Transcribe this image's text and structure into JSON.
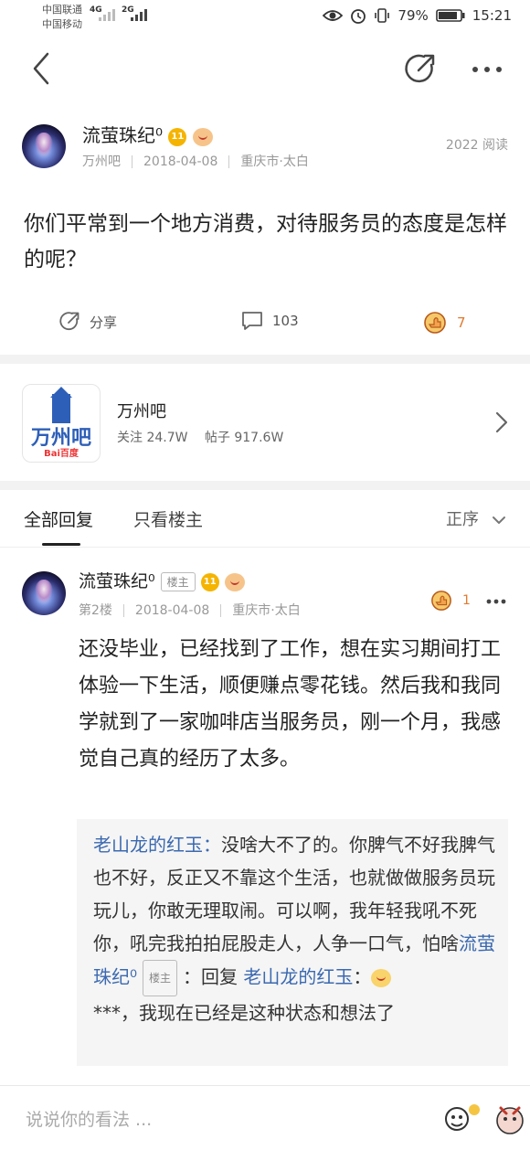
{
  "status_bar": {
    "carrier1": "中国联通",
    "carrier2": "中国移动",
    "net1": "4G",
    "net2": "2G",
    "battery": "79%",
    "time": "15:21"
  },
  "post": {
    "username": "流萤珠纪⁰",
    "level": "11",
    "reads": "2022 阅读",
    "forum": "万州吧",
    "date": "2018-04-08",
    "location": "重庆市·太白",
    "title": "你们平常到一个地方消费，对待服务员的态度是怎样的呢？",
    "share_label": "分享",
    "comment_count": "103",
    "like_count": "7"
  },
  "forum_card": {
    "logo_text": "万州吧",
    "logo_brand": "Bai百度",
    "name": "万州吧",
    "follow": "关注 24.7W",
    "posts": "帖子 917.6W"
  },
  "tabs": {
    "all": "全部回复",
    "host_only": "只看楼主",
    "sort": "正序"
  },
  "reply": {
    "username": "流萤珠纪⁰",
    "host_badge": "楼主",
    "level": "11",
    "floor": "第2楼",
    "date": "2018-04-08",
    "location": "重庆市·太白",
    "like_count": "1",
    "content": "还没毕业，已经找到了工作，想在实习期间打工体验一下生活，顺便赚点零花钱。然后我和我同学就到了一家咖啡店当服务员，刚一个月，我感觉自己真的经历了太多。",
    "sub1_user": "老山龙的红玉",
    "sub1_sep": "：",
    "sub1_text": "没啥大不了的。你脾气不好我脾气也不好，反正又不靠这个生活，也就做做服务员玩玩儿，你敢无理取闹。可以啊，我年轻我吼不死你，吼完我拍拍屁股走人，人争一口气，怕啥",
    "sub2_user": "流萤珠纪⁰",
    "sub2_badge": "楼主",
    "sub2_reply": "：回复 ",
    "sub2_target": "老山龙的红玉",
    "sub2_colon": "：",
    "sub2_text": "***，我现在已经是这种状态和想法了"
  },
  "comment_bar": {
    "placeholder": "说说你的看法 ..."
  }
}
